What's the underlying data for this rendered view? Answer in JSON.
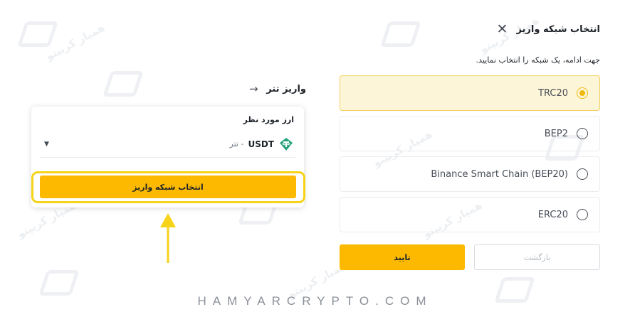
{
  "left_panel": {
    "title": "واریز تتر",
    "back_icon": "arrow-right-icon",
    "currency_label": "ارز مورد نظر",
    "coin_symbol": "USDT",
    "coin_name": "- تتر",
    "coin_icon": "usdt-icon",
    "choose_network_button": "انتخاب شبکه واریز",
    "highlight_color": "#f6d318"
  },
  "modal": {
    "title": "انتخاب شبکه واریز",
    "close_icon": "close-icon",
    "subtitle": "جهت ادامه، یک شبکه را انتخاب نمایید.",
    "networks": [
      {
        "label": "TRC20",
        "selected": true
      },
      {
        "label": "BEP2",
        "selected": false
      },
      {
        "label": "Binance Smart Chain (BEP20)",
        "selected": false
      },
      {
        "label": "ERC20",
        "selected": false
      }
    ],
    "confirm_button": "تایید",
    "back_button": "بازگشت"
  },
  "colors": {
    "accent": "#fcb900",
    "selected_bg": "#fdf5d8",
    "radio_active": "#f0b90b"
  },
  "watermark": {
    "text": "همیار کریپتو",
    "url": "www.hamyarcrypto.com",
    "brand": "HAMYARCRYPTO.COM"
  }
}
